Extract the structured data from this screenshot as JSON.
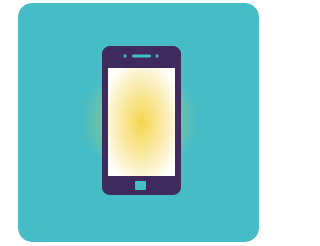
{
  "icon": {
    "name": "smartphone-icon",
    "colors": {
      "page_background": "#ffffff",
      "tile_background": "#45bcc6",
      "glow": "#f3d34a",
      "phone_body": "#3f2a5e",
      "screen_center": "#f5d64f",
      "screen_edge": "#ffffff",
      "speaker": "#45bcc6",
      "camera_dot": "#45bcc6",
      "home_button": "#45bcc6"
    }
  }
}
